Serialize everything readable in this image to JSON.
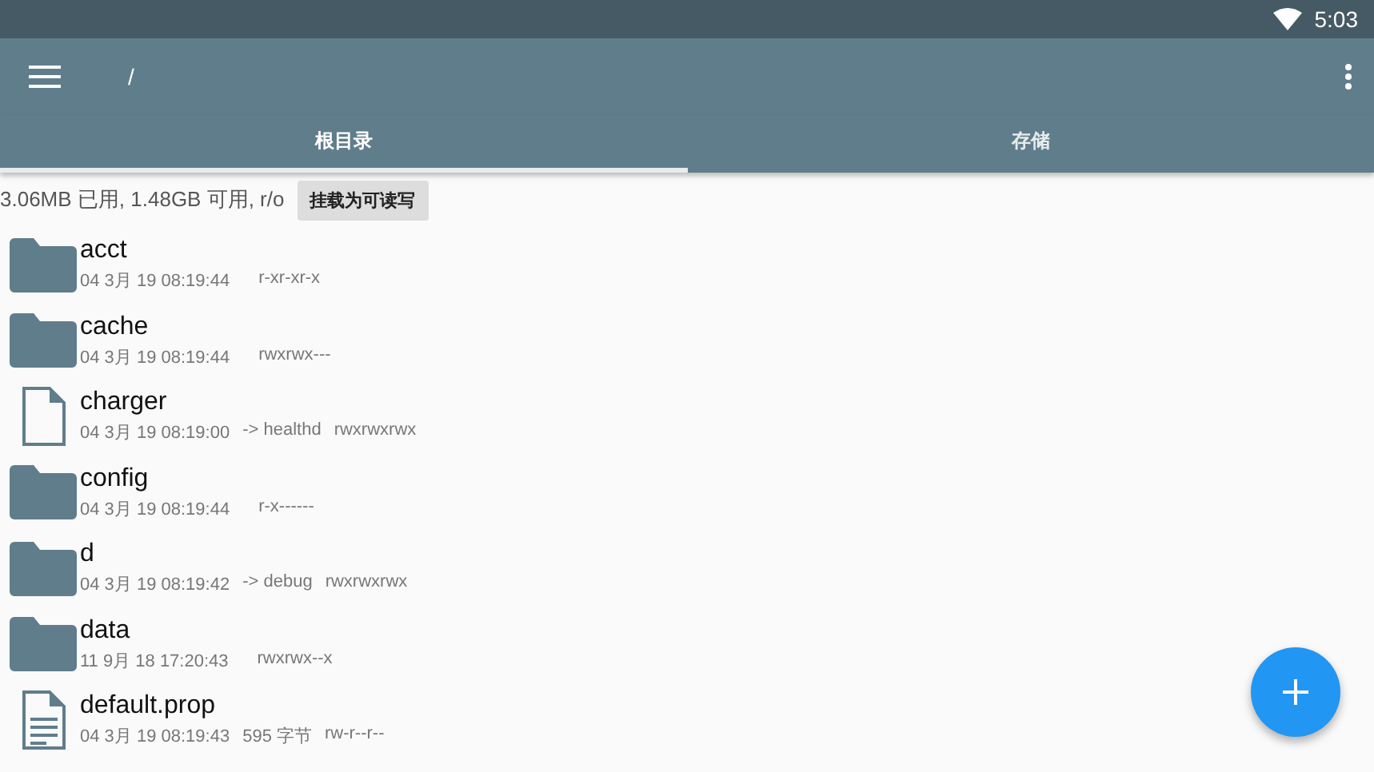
{
  "status_bar": {
    "time": "5:03"
  },
  "toolbar": {
    "path": "/"
  },
  "tabs": [
    {
      "label": "根目录",
      "selected": true
    },
    {
      "label": "存储",
      "selected": false
    }
  ],
  "storage_info": {
    "text": "3.06MB 已用, 1.48GB 可用, r/o",
    "button": "挂载为可读写"
  },
  "files": [
    {
      "name": "acct",
      "kind": "folder",
      "date": "04 3月 19 08:19:44",
      "perms": "r-xr-xr-x"
    },
    {
      "name": "cache",
      "kind": "folder",
      "date": "04 3月 19 08:19:44",
      "perms": "rwxrwx---"
    },
    {
      "name": "charger",
      "kind": "file",
      "date": "04 3月 19 08:19:00",
      "detail": "-> healthd",
      "perms": "rwxrwxrwx"
    },
    {
      "name": "config",
      "kind": "folder",
      "date": "04 3月 19 08:19:44",
      "perms": "r-x------"
    },
    {
      "name": "d",
      "kind": "folder",
      "date": "04 3月 19 08:19:42",
      "detail": "-> debug",
      "perms": "rwxrwxrwx"
    },
    {
      "name": "data",
      "kind": "folder",
      "date": "11 9月 18 17:20:43",
      "perms": "rwxrwx--x"
    },
    {
      "name": "default.prop",
      "kind": "text",
      "date": "04 3月 19 08:19:43",
      "detail": "595 字节",
      "perms": "rw-r--r--"
    }
  ]
}
